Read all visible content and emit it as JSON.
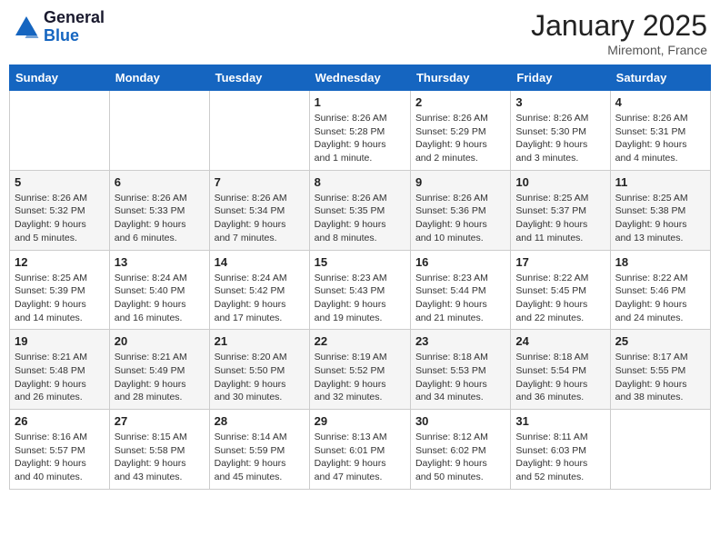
{
  "header": {
    "logo_general": "General",
    "logo_blue": "Blue",
    "month_title": "January 2025",
    "location": "Miremont, France"
  },
  "days_of_week": [
    "Sunday",
    "Monday",
    "Tuesday",
    "Wednesday",
    "Thursday",
    "Friday",
    "Saturday"
  ],
  "weeks": [
    [
      {
        "day": "",
        "info": ""
      },
      {
        "day": "",
        "info": ""
      },
      {
        "day": "",
        "info": ""
      },
      {
        "day": "1",
        "info": "Sunrise: 8:26 AM\nSunset: 5:28 PM\nDaylight: 9 hours\nand 1 minute."
      },
      {
        "day": "2",
        "info": "Sunrise: 8:26 AM\nSunset: 5:29 PM\nDaylight: 9 hours\nand 2 minutes."
      },
      {
        "day": "3",
        "info": "Sunrise: 8:26 AM\nSunset: 5:30 PM\nDaylight: 9 hours\nand 3 minutes."
      },
      {
        "day": "4",
        "info": "Sunrise: 8:26 AM\nSunset: 5:31 PM\nDaylight: 9 hours\nand 4 minutes."
      }
    ],
    [
      {
        "day": "5",
        "info": "Sunrise: 8:26 AM\nSunset: 5:32 PM\nDaylight: 9 hours\nand 5 minutes."
      },
      {
        "day": "6",
        "info": "Sunrise: 8:26 AM\nSunset: 5:33 PM\nDaylight: 9 hours\nand 6 minutes."
      },
      {
        "day": "7",
        "info": "Sunrise: 8:26 AM\nSunset: 5:34 PM\nDaylight: 9 hours\nand 7 minutes."
      },
      {
        "day": "8",
        "info": "Sunrise: 8:26 AM\nSunset: 5:35 PM\nDaylight: 9 hours\nand 8 minutes."
      },
      {
        "day": "9",
        "info": "Sunrise: 8:26 AM\nSunset: 5:36 PM\nDaylight: 9 hours\nand 10 minutes."
      },
      {
        "day": "10",
        "info": "Sunrise: 8:25 AM\nSunset: 5:37 PM\nDaylight: 9 hours\nand 11 minutes."
      },
      {
        "day": "11",
        "info": "Sunrise: 8:25 AM\nSunset: 5:38 PM\nDaylight: 9 hours\nand 13 minutes."
      }
    ],
    [
      {
        "day": "12",
        "info": "Sunrise: 8:25 AM\nSunset: 5:39 PM\nDaylight: 9 hours\nand 14 minutes."
      },
      {
        "day": "13",
        "info": "Sunrise: 8:24 AM\nSunset: 5:40 PM\nDaylight: 9 hours\nand 16 minutes."
      },
      {
        "day": "14",
        "info": "Sunrise: 8:24 AM\nSunset: 5:42 PM\nDaylight: 9 hours\nand 17 minutes."
      },
      {
        "day": "15",
        "info": "Sunrise: 8:23 AM\nSunset: 5:43 PM\nDaylight: 9 hours\nand 19 minutes."
      },
      {
        "day": "16",
        "info": "Sunrise: 8:23 AM\nSunset: 5:44 PM\nDaylight: 9 hours\nand 21 minutes."
      },
      {
        "day": "17",
        "info": "Sunrise: 8:22 AM\nSunset: 5:45 PM\nDaylight: 9 hours\nand 22 minutes."
      },
      {
        "day": "18",
        "info": "Sunrise: 8:22 AM\nSunset: 5:46 PM\nDaylight: 9 hours\nand 24 minutes."
      }
    ],
    [
      {
        "day": "19",
        "info": "Sunrise: 8:21 AM\nSunset: 5:48 PM\nDaylight: 9 hours\nand 26 minutes."
      },
      {
        "day": "20",
        "info": "Sunrise: 8:21 AM\nSunset: 5:49 PM\nDaylight: 9 hours\nand 28 minutes."
      },
      {
        "day": "21",
        "info": "Sunrise: 8:20 AM\nSunset: 5:50 PM\nDaylight: 9 hours\nand 30 minutes."
      },
      {
        "day": "22",
        "info": "Sunrise: 8:19 AM\nSunset: 5:52 PM\nDaylight: 9 hours\nand 32 minutes."
      },
      {
        "day": "23",
        "info": "Sunrise: 8:18 AM\nSunset: 5:53 PM\nDaylight: 9 hours\nand 34 minutes."
      },
      {
        "day": "24",
        "info": "Sunrise: 8:18 AM\nSunset: 5:54 PM\nDaylight: 9 hours\nand 36 minutes."
      },
      {
        "day": "25",
        "info": "Sunrise: 8:17 AM\nSunset: 5:55 PM\nDaylight: 9 hours\nand 38 minutes."
      }
    ],
    [
      {
        "day": "26",
        "info": "Sunrise: 8:16 AM\nSunset: 5:57 PM\nDaylight: 9 hours\nand 40 minutes."
      },
      {
        "day": "27",
        "info": "Sunrise: 8:15 AM\nSunset: 5:58 PM\nDaylight: 9 hours\nand 43 minutes."
      },
      {
        "day": "28",
        "info": "Sunrise: 8:14 AM\nSunset: 5:59 PM\nDaylight: 9 hours\nand 45 minutes."
      },
      {
        "day": "29",
        "info": "Sunrise: 8:13 AM\nSunset: 6:01 PM\nDaylight: 9 hours\nand 47 minutes."
      },
      {
        "day": "30",
        "info": "Sunrise: 8:12 AM\nSunset: 6:02 PM\nDaylight: 9 hours\nand 50 minutes."
      },
      {
        "day": "31",
        "info": "Sunrise: 8:11 AM\nSunset: 6:03 PM\nDaylight: 9 hours\nand 52 minutes."
      },
      {
        "day": "",
        "info": ""
      }
    ]
  ]
}
